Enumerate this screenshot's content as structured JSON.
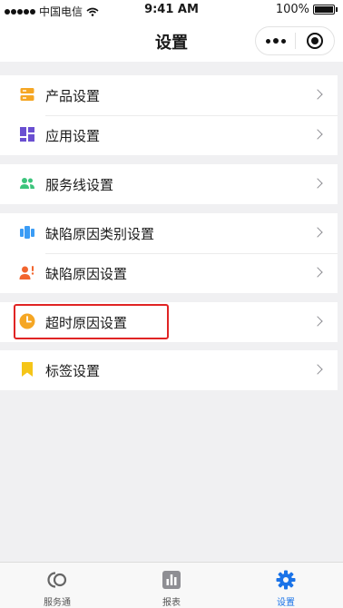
{
  "status_bar": {
    "carrier": "中国电信",
    "time": "9:41 AM",
    "battery": "100%"
  },
  "nav": {
    "title": "设置"
  },
  "groups": [
    {
      "items": [
        {
          "label": "产品设置",
          "icon": "server-icon",
          "color": "#f5a623"
        },
        {
          "label": "应用设置",
          "icon": "apps-grid-icon",
          "color": "#6a4fd1"
        }
      ]
    },
    {
      "items": [
        {
          "label": "服务线设置",
          "icon": "people-icon",
          "color": "#3cc47c"
        }
      ]
    },
    {
      "items": [
        {
          "label": "缺陷原因类别设置",
          "icon": "category-icon",
          "color": "#3b9cf5"
        },
        {
          "label": "缺陷原因设置",
          "icon": "person-alert-icon",
          "color": "#f2652e"
        }
      ]
    },
    {
      "items": [
        {
          "label": "超时原因设置",
          "icon": "clock-icon",
          "color": "#f5a623"
        }
      ]
    },
    {
      "items": [
        {
          "label": "标签设置",
          "icon": "bookmark-icon",
          "color": "#f5c518"
        }
      ]
    }
  ],
  "tab_bar": {
    "tabs": [
      {
        "label": "服务通",
        "icon": "service-logo-icon"
      },
      {
        "label": "报表",
        "icon": "bar-chart-icon"
      },
      {
        "label": "设置",
        "icon": "gear-icon",
        "active": true
      }
    ]
  },
  "colors": {
    "accent": "#1a73e8",
    "highlight": "#e02424"
  }
}
